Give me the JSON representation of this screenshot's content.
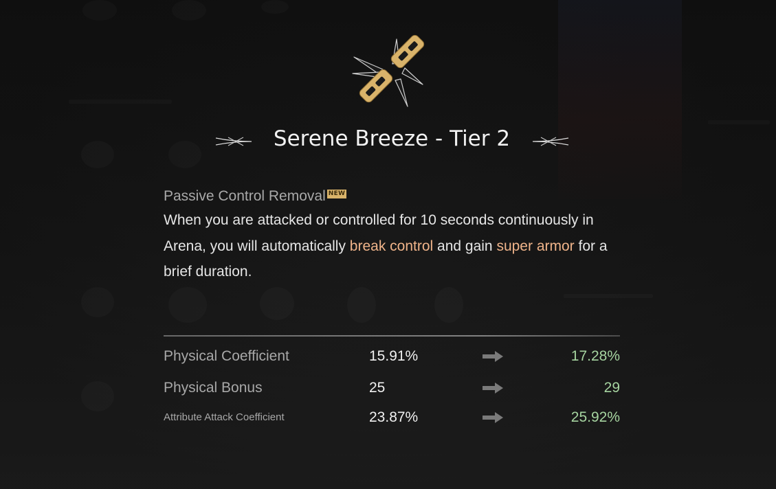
{
  "skill": {
    "title": "Serene Breeze - Tier 2",
    "icon": "broken-chain-icon",
    "accent_color": "#d9b36a"
  },
  "description": {
    "heading": "Passive Control Removal",
    "badge": "NEW",
    "text_part1": "When you are attacked or controlled for 10 seconds continuously in Arena, you will automatically ",
    "highlight1": "break control",
    "text_part2": " and gain ",
    "highlight2": "super armor",
    "text_part3": " for a brief duration.",
    "highlight_color": "#f0b48a"
  },
  "stats": [
    {
      "name": "Physical Coefficient",
      "current": "15.91%",
      "next": "17.28%"
    },
    {
      "name": "Physical Bonus",
      "current": "25",
      "next": "29"
    },
    {
      "name": "Attribute Attack Coefficient",
      "current": "23.87%",
      "next": "25.92%"
    }
  ],
  "colors": {
    "title": "#f2f2f2",
    "stat_next": "#a6d4a0",
    "stat_label": "#a8a8a8"
  }
}
